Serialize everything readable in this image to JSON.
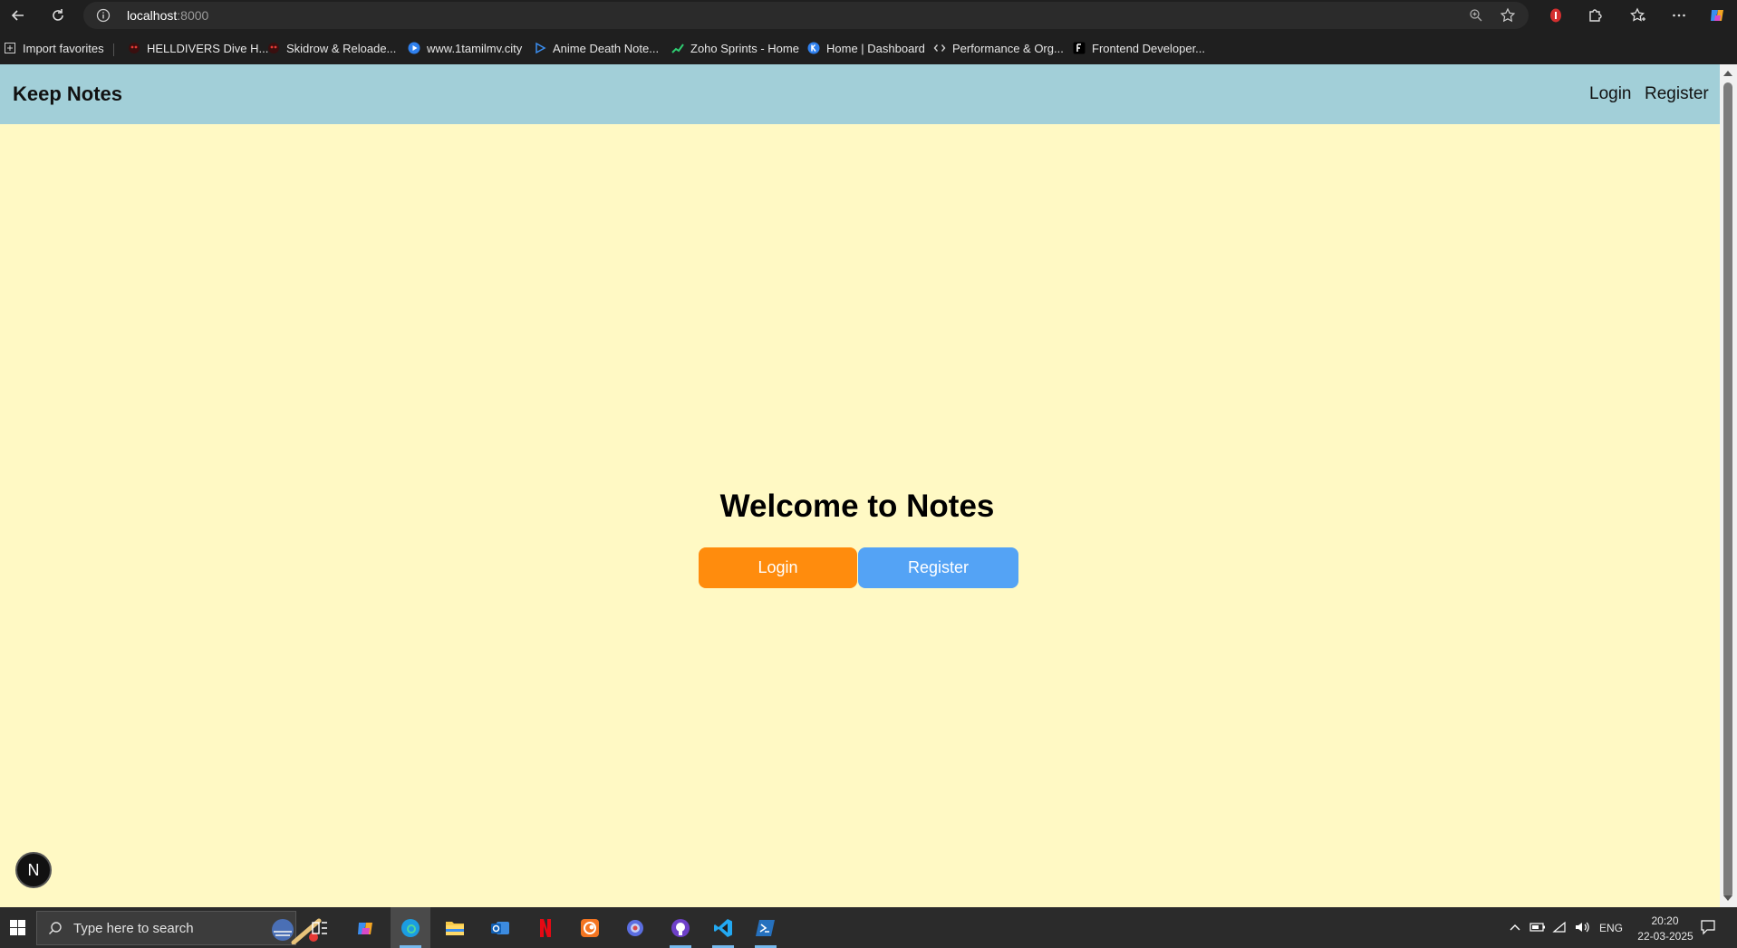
{
  "browser": {
    "url_host": "localhost",
    "url_port": ":8000",
    "bookmarks": [
      {
        "label": "Import favorites",
        "color": "#bbbbbb"
      },
      {
        "label": "HELLDIVERS Dive H...",
        "color": "#c0392b"
      },
      {
        "label": "Skidrow & Reloade...",
        "color": "#c0392b"
      },
      {
        "label": "www.1tamilmv.city",
        "color": "#3b8ef0"
      },
      {
        "label": "Anime Death Note...",
        "color": "#3b8ef0"
      },
      {
        "label": "Zoho Sprints - Home",
        "color": "#2ecc71"
      },
      {
        "label": "Home | Dashboard",
        "color": "#3b8ef0"
      },
      {
        "label": "Performance & Org...",
        "color": "#bbbbbb"
      },
      {
        "label": "Frontend Developer...",
        "color": "#ffffff"
      }
    ]
  },
  "page": {
    "brand": "Keep Notes",
    "nav": {
      "login": "Login",
      "register": "Register"
    },
    "heading": "Welcome to Notes",
    "buttons": {
      "login": "Login",
      "register": "Register"
    },
    "badge": "N",
    "colors": {
      "navbar": "#a2cfd8",
      "background": "#fff9c4",
      "login_button": "#ff8c0d",
      "register_button": "#54a3f5"
    }
  },
  "taskbar": {
    "search_placeholder": "Type here to search",
    "language": "ENG",
    "time": "20:20",
    "date": "22-03-2025"
  }
}
